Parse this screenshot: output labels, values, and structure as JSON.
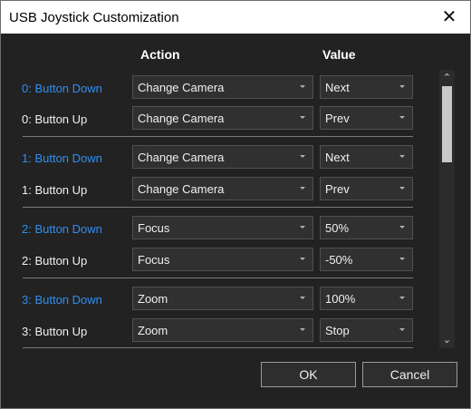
{
  "window": {
    "title": "USB Joystick Customization"
  },
  "headers": {
    "action": "Action",
    "value": "Value"
  },
  "rows": [
    {
      "label": "0: Button Down",
      "action": "Change Camera",
      "value": "Next"
    },
    {
      "label": "0: Button Up",
      "action": "Change Camera",
      "value": "Prev"
    },
    {
      "label": "1: Button Down",
      "action": "Change Camera",
      "value": "Next"
    },
    {
      "label": "1: Button Up",
      "action": "Change Camera",
      "value": "Prev"
    },
    {
      "label": "2: Button Down",
      "action": "Focus",
      "value": "50%"
    },
    {
      "label": "2: Button Up",
      "action": "Focus",
      "value": "-50%"
    },
    {
      "label": "3: Button Down",
      "action": "Zoom",
      "value": "100%"
    },
    {
      "label": "3: Button Up",
      "action": "Zoom",
      "value": "Stop"
    }
  ],
  "buttons": {
    "ok": "OK",
    "cancel": "Cancel"
  },
  "icons": {
    "close": "close-icon",
    "scroll_up": "chevron-up-icon",
    "scroll_down": "chevron-down-icon",
    "dropdown": "chevron-down-icon"
  },
  "colors": {
    "down_label": "#2f8ef5",
    "background": "#222222",
    "titlebar": "#ffffff"
  }
}
